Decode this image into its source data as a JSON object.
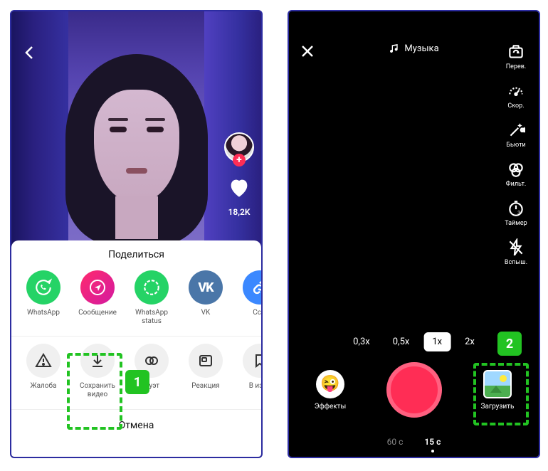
{
  "left": {
    "like_count": "18,2K",
    "share_title": "Поделиться",
    "row1": [
      {
        "label": "WhatsApp"
      },
      {
        "label": "Сообщение"
      },
      {
        "label": "WhatsApp status"
      },
      {
        "label": "VK"
      },
      {
        "label": "Ссы"
      }
    ],
    "row2": [
      {
        "label": "Жалоба"
      },
      {
        "label": "Сохранить видео"
      },
      {
        "label": "Дуэт"
      },
      {
        "label": "Реакция"
      },
      {
        "label": "В избр"
      }
    ],
    "cancel": "Отмена",
    "step_badge": "1"
  },
  "right": {
    "music_label": "Музыка",
    "tools": [
      {
        "label": "Перев."
      },
      {
        "label": "Скор."
      },
      {
        "label": "Бьюти"
      },
      {
        "label": "Фильт."
      },
      {
        "label": "Таймер"
      },
      {
        "label": "Вспыш."
      }
    ],
    "zooms": [
      "0,3x",
      "0,5x",
      "1x",
      "2x"
    ],
    "zoom_active_index": 2,
    "effects_label": "Эффекты",
    "upload_label": "Загрузить",
    "durations": [
      "60 с",
      "15 с"
    ],
    "duration_active_index": 1,
    "step_badge": "2"
  }
}
